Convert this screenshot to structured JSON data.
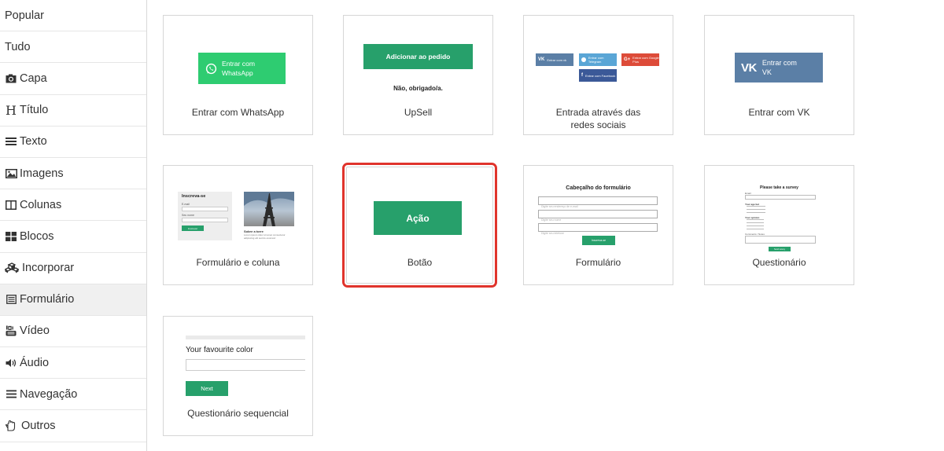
{
  "sidebar": {
    "items": [
      {
        "label": "Popular",
        "icon": ""
      },
      {
        "label": "Tudo",
        "icon": ""
      },
      {
        "label": "Capa",
        "icon": "camera-icon"
      },
      {
        "label": "Título",
        "icon": "heading-icon"
      },
      {
        "label": "Texto",
        "icon": "text-lines-icon"
      },
      {
        "label": "Imagens",
        "icon": "image-icon"
      },
      {
        "label": "Colunas",
        "icon": "columns-icon"
      },
      {
        "label": "Blocos",
        "icon": "blocks-icon"
      },
      {
        "label": "Incorporar",
        "icon": "cubes-icon"
      },
      {
        "label": "Formulário",
        "icon": "form-icon"
      },
      {
        "label": "Vídeo",
        "icon": "youtube-icon"
      },
      {
        "label": "Áudio",
        "icon": "volume-icon"
      },
      {
        "label": "Navegação",
        "icon": "menu-icon"
      },
      {
        "label": "Outros",
        "icon": "hand-icon"
      }
    ],
    "active": "Formulário"
  },
  "cards": {
    "whatsapp": {
      "caption": "Entrar com WhatsApp",
      "button_line1": "Entrar com",
      "button_line2": "WhatsApp"
    },
    "upsell": {
      "caption": "UpSell",
      "button": "Adicionar ao pedido",
      "decline": "Não, obrigado/a."
    },
    "social": {
      "caption": "Entrada através das redes sociais",
      "vk": "Entrar com vk",
      "telegram": "Entrar com Telegram",
      "google": "Entrar com Google Plus",
      "facebook": "Entrar com Facebook"
    },
    "vk": {
      "caption": "Entrar com VK",
      "button_line1": "Entrar com",
      "button_line2": "VK"
    },
    "form_column": {
      "caption": "Formulário e coluna",
      "heading": "Inscreva-se",
      "label_email": "E-mail",
      "label_name": "Seu nome",
      "button": "Inscrever",
      "side_title": "Sobre a torre",
      "side_text": "Lorem ipsum dolor sit amet consectetur adipiscing elit sed do eiusmod"
    },
    "button": {
      "caption": "Botão",
      "button": "Ação"
    },
    "form": {
      "caption": "Formulário",
      "title": "Cabeçalho do formulário",
      "field1": "Digite seu endereço de e-mail",
      "field2": "Digite seu nome",
      "field3": "Digite seu telefone",
      "button": "Inscreva-se"
    },
    "questionnaire": {
      "caption": "Questionário",
      "title": "Please take a survey",
      "email_label": "Email",
      "q1": "Your age bet",
      "q2": "Your opinion",
      "comment": "Comments / Notes",
      "button": "Send survey"
    },
    "sequential": {
      "caption": "Questionário sequencial",
      "question": "Your favourite color",
      "button": "Next"
    }
  },
  "colors": {
    "whatsapp": "#2ecc71",
    "green": "#27a06b",
    "vk": "#5b7fa6",
    "telegram": "#5aa6d6",
    "google": "#dd4b39",
    "facebook": "#3b5998",
    "selected_outline": "#e0342c"
  }
}
